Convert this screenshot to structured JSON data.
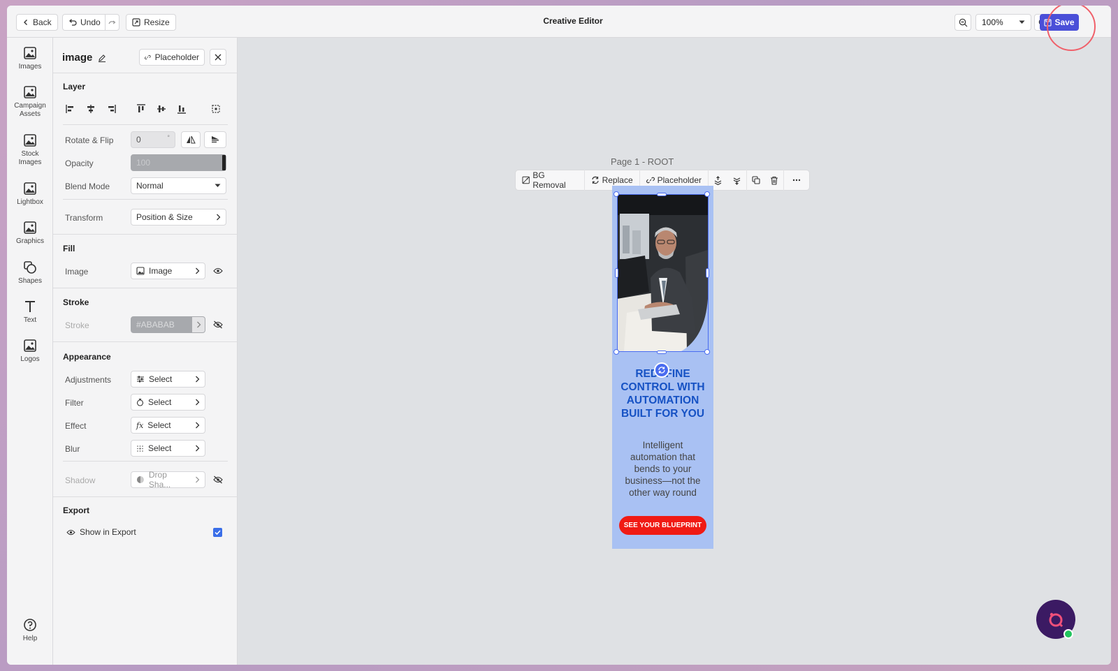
{
  "topbar": {
    "back_label": "Back",
    "undo_label": "Undo",
    "resize_label": "Resize",
    "title": "Creative Editor",
    "zoom_value": "100%",
    "save_label": "Save"
  },
  "rail": {
    "items": [
      {
        "label": "Images",
        "icon": "image-icon"
      },
      {
        "label": "Campaign Assets",
        "icon": "image-icon"
      },
      {
        "label": "Stock Images",
        "icon": "image-icon"
      },
      {
        "label": "Lightbox",
        "icon": "image-icon"
      },
      {
        "label": "Graphics",
        "icon": "image-icon"
      },
      {
        "label": "Shapes",
        "icon": "shapes-icon"
      },
      {
        "label": "Text",
        "icon": "text-icon"
      },
      {
        "label": "Logos",
        "icon": "image-icon"
      }
    ],
    "help_label": "Help"
  },
  "panel": {
    "element_name": "image",
    "placeholder_label": "Placeholder",
    "layer": {
      "title": "Layer",
      "rotate_label": "Rotate & Flip",
      "rotate_value": "0",
      "rotate_unit": "°",
      "opacity_label": "Opacity",
      "opacity_value": "100",
      "blend_label": "Blend Mode",
      "blend_value": "Normal",
      "transform_label": "Transform",
      "transform_value": "Position & Size"
    },
    "fill": {
      "title": "Fill",
      "image_label": "Image",
      "image_value": "Image"
    },
    "stroke": {
      "title": "Stroke",
      "stroke_label": "Stroke",
      "stroke_value": "#ABABAB"
    },
    "appearance": {
      "title": "Appearance",
      "adjustments_label": "Adjustments",
      "adjustments_value": "Select",
      "filter_label": "Filter",
      "filter_value": "Select",
      "effect_label": "Effect",
      "effect_value": "Select",
      "blur_label": "Blur",
      "blur_value": "Select",
      "shadow_label": "Shadow",
      "shadow_value": "Drop Sha..."
    },
    "export": {
      "title": "Export",
      "show_label": "Show in Export",
      "checked": true
    }
  },
  "canvas": {
    "page_label": "Page 1 - ROOT",
    "toolbar": {
      "bg_removal": "BG Removal",
      "replace": "Replace",
      "placeholder": "Placeholder"
    },
    "ad": {
      "headline": "REDEFINE CONTROL WITH AUTOMATION BUILT FOR YOU",
      "subcopy": "Intelligent automation that bends to your business—not the other way round",
      "cta": "SEE YOUR BLUEPRINT",
      "background_color": "#A9C1F3",
      "headline_color": "#1652C4",
      "cta_color": "#F01A14"
    }
  },
  "colors": {
    "accent": "#4A4FD8",
    "selection": "#4A6CF0"
  }
}
